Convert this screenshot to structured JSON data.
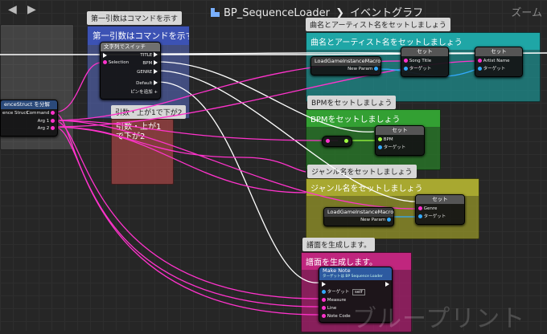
{
  "toolbar": {
    "back_icon": "◀",
    "forward_icon": "▶",
    "breadcrumb_root": "BP_SequenceLoader",
    "breadcrumb_separator": "❯",
    "breadcrumb_current": "イベントグラフ",
    "zoom_label": "ズーム"
  },
  "comments": {
    "first_arg": {
      "bubble": "第一引数はコマンドを示す",
      "title": "第一引数はコマンドを示す"
    },
    "arg_bpm": {
      "bubble": "引数・上が1で下が2",
      "title": "引数・上が1で下が2"
    },
    "song": {
      "bubble": "曲名とアーティスト名をセットしましょう",
      "title": "曲名とアーティスト名をセットしましょう"
    },
    "bpm": {
      "bubble": "BPMをセットしましょう",
      "title": "BPMをセットしましょう"
    },
    "genre": {
      "bubble": "ジャンル名をセットしましょう",
      "title": "ジャンル名をセットしましょう"
    },
    "note": {
      "bubble": "譜面を生成します。",
      "title": "譜面を生成します。"
    }
  },
  "nodes": {
    "break_struct": {
      "title": "enceStruct を分解",
      "in_label": "ence Struct",
      "pins": [
        "Command",
        "Arg 1",
        "Arg 2"
      ]
    },
    "switch": {
      "title": "文字列でスイッチ",
      "selection": "Selection",
      "cases": [
        "TITLE",
        "BPM",
        "GENRE"
      ],
      "default": "Default",
      "add_pin": "ピンを追加"
    },
    "load_1": {
      "title": "LoadGameInstanceMacro",
      "out": "New Param"
    },
    "set_song": {
      "title": "セット",
      "pins": [
        "Song Title",
        "ターゲット"
      ]
    },
    "set_artist": {
      "title": "セット",
      "pins": [
        "Artist Name",
        "ターゲット"
      ]
    },
    "set_bpm": {
      "title": "セット",
      "pins": [
        "BPM",
        "ターゲット"
      ]
    },
    "load_2": {
      "title": "LoadGameInstanceMacro",
      "out": "New Param"
    },
    "set_genre": {
      "title": "セット",
      "pins": [
        "Genre",
        "ターゲット"
      ]
    },
    "make_note": {
      "title": "Make Note",
      "subtitle": "ターゲットは BP Sequence Loader",
      "pins": [
        "ターゲット",
        "Measure",
        "Line",
        "Note Code"
      ],
      "self_label": "self"
    }
  },
  "watermark": "ブループリント",
  "colors": {
    "exec": "#ffffff",
    "string": "#ff33cc",
    "object": "#33aaff",
    "float": "#a0ff40"
  }
}
